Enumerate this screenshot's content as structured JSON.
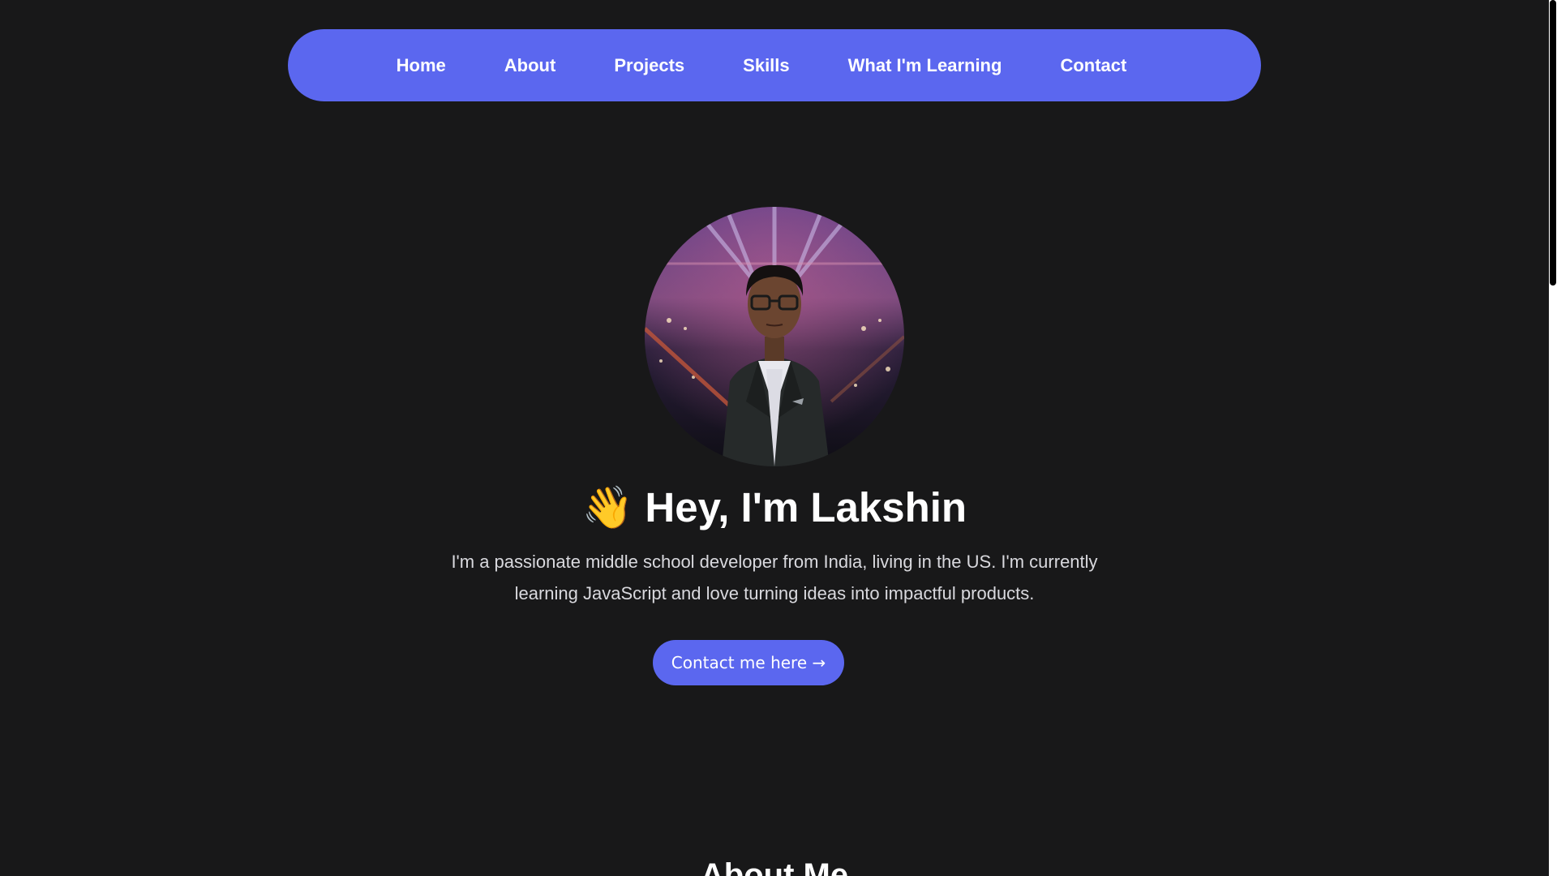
{
  "nav": {
    "items": [
      {
        "label": "Home"
      },
      {
        "label": "About"
      },
      {
        "label": "Projects"
      },
      {
        "label": "Skills"
      },
      {
        "label": "What I'm Learning"
      },
      {
        "label": "Contact"
      }
    ]
  },
  "hero": {
    "avatar_icon": "profile-photo",
    "emoji": "👋",
    "title": "Hey, I'm Lakshin",
    "description": "I'm a passionate middle school developer from India, living in the US. I'm currently learning JavaScript and love turning ideas into impactful products.",
    "cta_label": "Contact me here →"
  },
  "about": {
    "title": "About Me"
  },
  "colors": {
    "background": "#181819",
    "accent": "#5b67ef",
    "text": "#ffffff",
    "muted_text": "#d9d9de"
  }
}
